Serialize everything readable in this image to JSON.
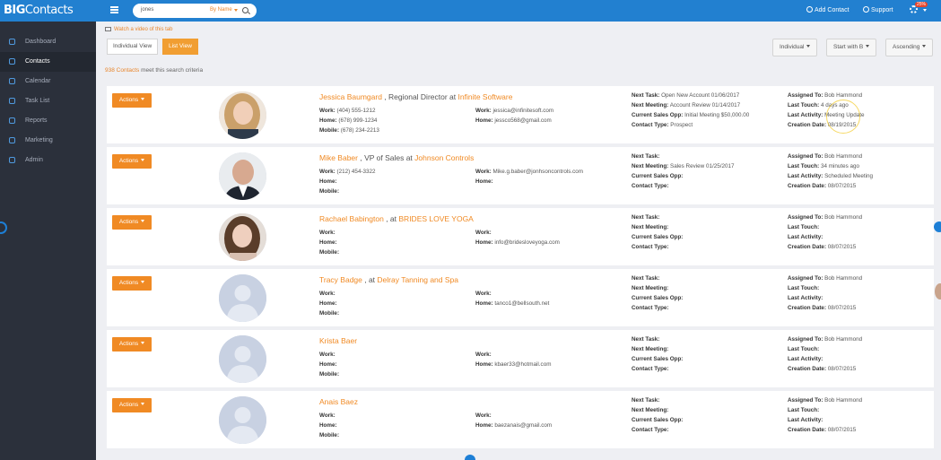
{
  "app": {
    "logo_bold": "BIG",
    "logo_light": "Contacts",
    "search_query": "jones",
    "search_by": "By Name",
    "add_contact": "Add Contact",
    "support": "Support",
    "notif_count": "25%"
  },
  "sidebar": {
    "items": [
      {
        "label": "Dashboard"
      },
      {
        "label": "Contacts"
      },
      {
        "label": "Calendar"
      },
      {
        "label": "Task List"
      },
      {
        "label": "Reports"
      },
      {
        "label": "Marketing"
      },
      {
        "label": "Admin"
      }
    ]
  },
  "main": {
    "video_link": "Watch a video of this tab",
    "individual_view": "Individual View",
    "list_view": "List View",
    "sort_type": "Individual",
    "start_with": "Start with B",
    "order": "Ascending",
    "criteria_count": "938 Contacts",
    "criteria_text": " meet this search criteria",
    "actions_label": "Actions"
  },
  "labels": {
    "work": "Work:",
    "home": "Home:",
    "mobile": "Mobile:",
    "next_task": "Next Task:",
    "next_meeting": "Next Meeting:",
    "current_sales_opp": "Current Sales Opp:",
    "contact_type": "Contact Type:",
    "assigned_to": "Assigned To:",
    "last_touch": "Last Touch:",
    "last_activity": "Last Activity:",
    "creation_date": "Creation Date:"
  },
  "contacts": [
    {
      "name": "Jessica Baumgard",
      "title": " , Regional Director at ",
      "company": "Infinite Software",
      "work_phone": "(404) 555-1212",
      "home_phone": "(678) 999-1234",
      "mobile": "(678) 234-2213",
      "work_email": "jessica@infinitesoft.com",
      "home_email": "jessco568@gmail.com",
      "next_task": "Open New Account 01/06/2017",
      "next_meeting": "Account Review 01/14/2017",
      "sales_opp": "Initial Meeting $50,000.00",
      "contact_type": "Prospect",
      "assigned_to": "Bob Hammond",
      "last_touch": "4 days ago",
      "last_activity": "Meeting Update",
      "creation_date": "08/19/2015"
    },
    {
      "name": "Mike Baber",
      "title": " , VP of Sales at ",
      "company": "Johnson Controls",
      "work_phone": "(212) 454-3322",
      "home_phone": "",
      "mobile": "",
      "work_email": "Mike.g.baber@jonhsoncontrols.com",
      "home_email": "",
      "next_task": "",
      "next_meeting": "Sales Review 01/25/2017",
      "sales_opp": "",
      "contact_type": "",
      "assigned_to": "Bob Hammond",
      "last_touch": "34 minutes ago",
      "last_activity": "Scheduled Meeting",
      "creation_date": "08/07/2015"
    },
    {
      "name": "Rachael Babington",
      "title": " , at ",
      "company": "BRIDES LOVE YOGA",
      "work_phone": "",
      "home_phone": "",
      "mobile": "",
      "work_email": "",
      "home_email": "info@bridesloveyoga.com",
      "next_task": "",
      "next_meeting": "",
      "sales_opp": "",
      "contact_type": "",
      "assigned_to": "Bob Hammond",
      "last_touch": "",
      "last_activity": "",
      "creation_date": "08/07/2015"
    },
    {
      "name": "Tracy Badge",
      "title": " , at ",
      "company": "Delray Tanning and Spa",
      "work_phone": "",
      "home_phone": "",
      "mobile": "",
      "work_email": "",
      "home_email": "tanco1@bellsouth.net",
      "next_task": "",
      "next_meeting": "",
      "sales_opp": "",
      "contact_type": "",
      "assigned_to": "Bob Hammond",
      "last_touch": "",
      "last_activity": "",
      "creation_date": "08/07/2015"
    },
    {
      "name": "Krista Baer",
      "title": "",
      "company": "",
      "work_phone": "",
      "home_phone": "",
      "mobile": "",
      "work_email": "",
      "home_email": "kbaer33@hotmail.com",
      "next_task": "",
      "next_meeting": "",
      "sales_opp": "",
      "contact_type": "",
      "assigned_to": "Bob Hammond",
      "last_touch": "",
      "last_activity": "",
      "creation_date": "08/07/2015"
    },
    {
      "name": "Anais Baez",
      "title": "",
      "company": "",
      "work_phone": "",
      "home_phone": "",
      "mobile": "",
      "work_email": "",
      "home_email": "baezanais@gmail.com",
      "next_task": "",
      "next_meeting": "",
      "sales_opp": "",
      "contact_type": "",
      "assigned_to": "Bob Hammond",
      "last_touch": "",
      "last_activity": "",
      "creation_date": "08/07/2015"
    }
  ],
  "colors": {
    "topbar": "#2280d0",
    "sidebar": "#2b303b",
    "accent": "#f08a24"
  }
}
